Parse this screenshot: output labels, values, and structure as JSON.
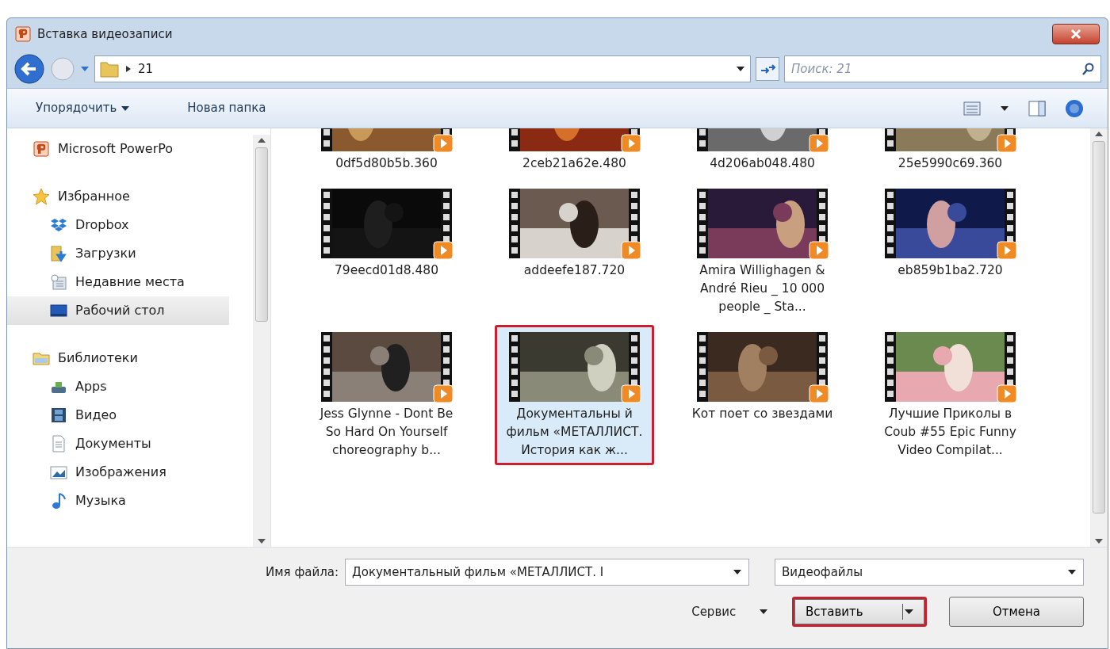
{
  "window": {
    "title": "Вставка видеозаписи"
  },
  "address": {
    "path": "21",
    "search_placeholder": "Поиск: 21"
  },
  "toolbar": {
    "organize": "Упорядочить",
    "new_folder": "Новая папка"
  },
  "sidebar": {
    "groups": [
      {
        "label": "Microsoft PowerPo",
        "kind": "app",
        "selected": false
      },
      {
        "label": "Избранное",
        "kind": "star",
        "selected": false,
        "children": [
          {
            "label": "Dropbox",
            "kind": "dropbox",
            "selected": false
          },
          {
            "label": "Загрузки",
            "kind": "downloads",
            "selected": false
          },
          {
            "label": "Недавние места",
            "kind": "recent",
            "selected": false
          },
          {
            "label": "Рабочий стол",
            "kind": "desktop",
            "selected": true
          }
        ]
      },
      {
        "label": "Библиотеки",
        "kind": "library",
        "selected": false,
        "children": [
          {
            "label": "Apps",
            "kind": "apps",
            "selected": false
          },
          {
            "label": "Видео",
            "kind": "video",
            "selected": false
          },
          {
            "label": "Документы",
            "kind": "docs",
            "selected": false
          },
          {
            "label": "Изображения",
            "kind": "images",
            "selected": false
          },
          {
            "label": "Музыка",
            "kind": "music",
            "selected": false
          }
        ]
      }
    ]
  },
  "files": [
    {
      "name": "0df5d80b5b.360",
      "selected": false,
      "highlighted": false
    },
    {
      "name": "2ceb21a62e.480",
      "selected": false,
      "highlighted": false
    },
    {
      "name": "4d206ab048.480",
      "selected": false,
      "highlighted": false
    },
    {
      "name": "25e5990c69.360",
      "selected": false,
      "highlighted": false
    },
    {
      "name": "79eecd01d8.480",
      "selected": false,
      "highlighted": false
    },
    {
      "name": "addeefe187.720",
      "selected": false,
      "highlighted": false
    },
    {
      "name": "Amira Willighagen & André Rieu _ 10 000 people _ Sta...",
      "selected": false,
      "highlighted": false
    },
    {
      "name": "eb859b1ba2.720",
      "selected": false,
      "highlighted": false
    },
    {
      "name": "Jess Glynne - Dont Be So Hard On Yourself choreography b...",
      "selected": false,
      "highlighted": false
    },
    {
      "name": "Документальны й фильм «МЕТАЛЛИСТ. История как ж...",
      "selected": true,
      "highlighted": true
    },
    {
      "name": "Кот поет со звездами",
      "selected": false,
      "highlighted": false
    },
    {
      "name": "Лучшие Приколы в Coub #55 Epic Funny Video Compilat...",
      "selected": false,
      "highlighted": false
    }
  ],
  "footer": {
    "filename_label": "Имя файла:",
    "filename": "Документальный фильм «МЕТАЛЛИСТ. I",
    "filetype": "Видеофайлы",
    "tools": "Сервис",
    "buttons": [
      {
        "label": "Вставить",
        "kind": "split",
        "highlighted": true
      },
      {
        "label": "Отмена",
        "kind": "plain",
        "highlighted": false
      }
    ]
  }
}
